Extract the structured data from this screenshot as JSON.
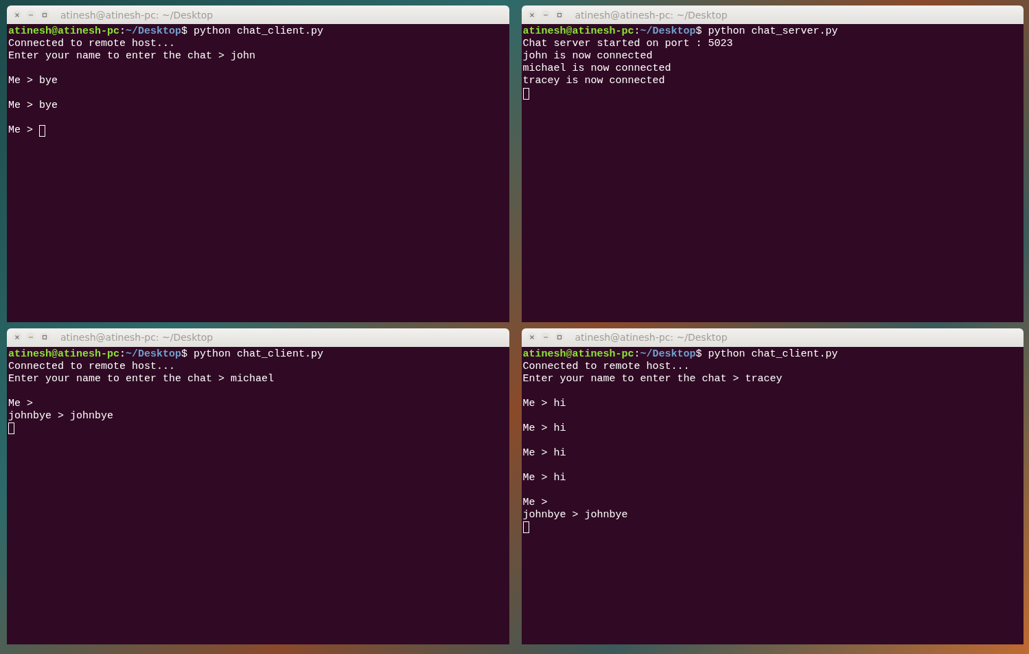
{
  "windows": [
    {
      "title": "atinesh@atinesh-pc: ~/Desktop",
      "lines": [
        {
          "kind": "prompt",
          "user": "atinesh@atinesh-pc",
          "colon": ":",
          "path": "~/Desktop",
          "sign": "$",
          "command": "python chat_client.py"
        },
        {
          "kind": "text",
          "text": "Connected to remote host..."
        },
        {
          "kind": "text",
          "text": "Enter your name to enter the chat > john"
        },
        {
          "kind": "blank"
        },
        {
          "kind": "text",
          "text": "Me > bye"
        },
        {
          "kind": "blank"
        },
        {
          "kind": "text",
          "text": "Me > bye"
        },
        {
          "kind": "blank"
        },
        {
          "kind": "cursor",
          "text": "Me >"
        }
      ]
    },
    {
      "title": "atinesh@atinesh-pc: ~/Desktop",
      "lines": [
        {
          "kind": "prompt",
          "user": "atinesh@atinesh-pc",
          "colon": ":",
          "path": "~/Desktop",
          "sign": "$",
          "command": "python chat_server.py"
        },
        {
          "kind": "text",
          "text": "Chat server started on port : 5023"
        },
        {
          "kind": "text",
          "text": "john is now connected"
        },
        {
          "kind": "text",
          "text": "michael is now connected"
        },
        {
          "kind": "text",
          "text": "tracey is now connected"
        },
        {
          "kind": "cursor"
        }
      ]
    },
    {
      "title": "atinesh@atinesh-pc: ~/Desktop",
      "lines": [
        {
          "kind": "prompt",
          "user": "atinesh@atinesh-pc",
          "colon": ":",
          "path": "~/Desktop",
          "sign": "$",
          "command": "python chat_client.py"
        },
        {
          "kind": "text",
          "text": "Connected to remote host..."
        },
        {
          "kind": "text",
          "text": "Enter your name to enter the chat > michael"
        },
        {
          "kind": "blank"
        },
        {
          "kind": "text",
          "text": "Me >"
        },
        {
          "kind": "text",
          "text": "johnbye > johnbye"
        },
        {
          "kind": "cursor"
        }
      ]
    },
    {
      "title": "atinesh@atinesh-pc: ~/Desktop",
      "lines": [
        {
          "kind": "prompt",
          "user": "atinesh@atinesh-pc",
          "colon": ":",
          "path": "~/Desktop",
          "sign": "$",
          "command": "python chat_client.py"
        },
        {
          "kind": "text",
          "text": "Connected to remote host..."
        },
        {
          "kind": "text",
          "text": "Enter your name to enter the chat > tracey"
        },
        {
          "kind": "blank"
        },
        {
          "kind": "text",
          "text": "Me > hi"
        },
        {
          "kind": "blank"
        },
        {
          "kind": "text",
          "text": "Me > hi"
        },
        {
          "kind": "blank"
        },
        {
          "kind": "text",
          "text": "Me > hi"
        },
        {
          "kind": "blank"
        },
        {
          "kind": "text",
          "text": "Me > hi"
        },
        {
          "kind": "blank"
        },
        {
          "kind": "text",
          "text": "Me >"
        },
        {
          "kind": "text",
          "text": "johnbye > johnbye"
        },
        {
          "kind": "cursor"
        }
      ]
    }
  ]
}
